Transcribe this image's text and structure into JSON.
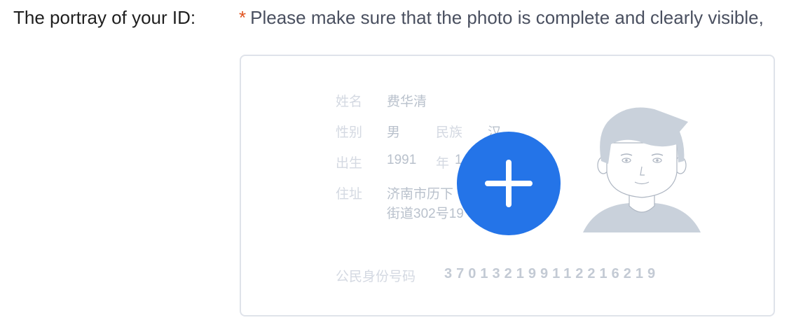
{
  "form": {
    "label": "The portray of your ID:",
    "required_mark": "*",
    "hint": "Please make sure that the photo is complete and clearly visible,"
  },
  "id_card": {
    "name_label": "姓名",
    "name_value": "费华清",
    "sex_label": "性别",
    "sex_value": "男",
    "ethnic_label": "民族",
    "ethnic_value": "汉",
    "birth_label": "出生",
    "birth_year": "1991",
    "birth_year_unit": "年",
    "birth_month_partial": "1",
    "address_label": "住址",
    "address_line1": "济南市历下",
    "address_line2": "街道302号19",
    "id_number_label": "公民身份号码",
    "id_number": "370132199112216219"
  },
  "upload": {
    "button_icon": "plus-icon",
    "accent_color": "#2474e8"
  }
}
